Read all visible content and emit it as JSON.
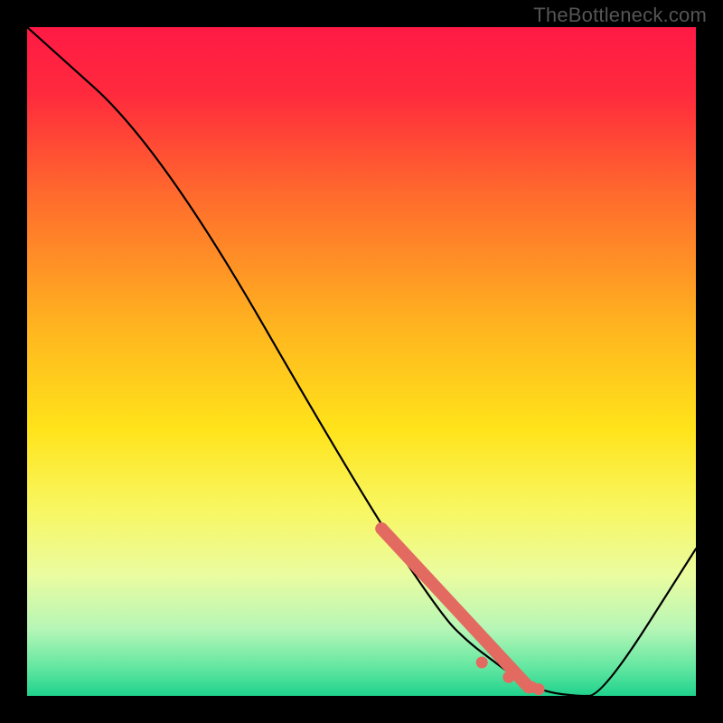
{
  "watermark": "TheBottleneck.com",
  "chart_data": {
    "type": "line",
    "title": "",
    "xlabel": "",
    "ylabel": "",
    "xlim": [
      0,
      100
    ],
    "ylim": [
      0,
      100
    ],
    "grid": false,
    "legend_position": "none",
    "series": [
      {
        "name": "bottleneck-curve",
        "x": [
          0,
          20,
          50,
          62,
          66,
          70,
          74,
          78,
          82,
          86,
          100
        ],
        "values": [
          100,
          82,
          30,
          12,
          8,
          5,
          2,
          0.5,
          0,
          0,
          22
        ]
      }
    ],
    "highlight_segment": {
      "name": "recommended-range",
      "x": [
        53,
        75
      ],
      "values": [
        25.0,
        1.3
      ],
      "style": "thick"
    },
    "highlight_points": {
      "name": "recommended-dots",
      "points": [
        {
          "x": 68.0,
          "y": 5.0
        },
        {
          "x": 72.0,
          "y": 2.8
        },
        {
          "x": 75.5,
          "y": 1.3
        },
        {
          "x": 76.5,
          "y": 1.0
        }
      ]
    },
    "background_gradient": [
      {
        "stop": 0.0,
        "color": "#ff1a45"
      },
      {
        "stop": 0.1,
        "color": "#ff2a3d"
      },
      {
        "stop": 0.25,
        "color": "#ff6a2d"
      },
      {
        "stop": 0.45,
        "color": "#ffb51f"
      },
      {
        "stop": 0.6,
        "color": "#ffe31a"
      },
      {
        "stop": 0.72,
        "color": "#f8f761"
      },
      {
        "stop": 0.82,
        "color": "#eafca0"
      },
      {
        "stop": 0.9,
        "color": "#b6f6b6"
      },
      {
        "stop": 0.96,
        "color": "#5fe6a0"
      },
      {
        "stop": 1.0,
        "color": "#1fd28c"
      }
    ],
    "curve_color": "#000000",
    "highlight_color": "#e36a61"
  }
}
